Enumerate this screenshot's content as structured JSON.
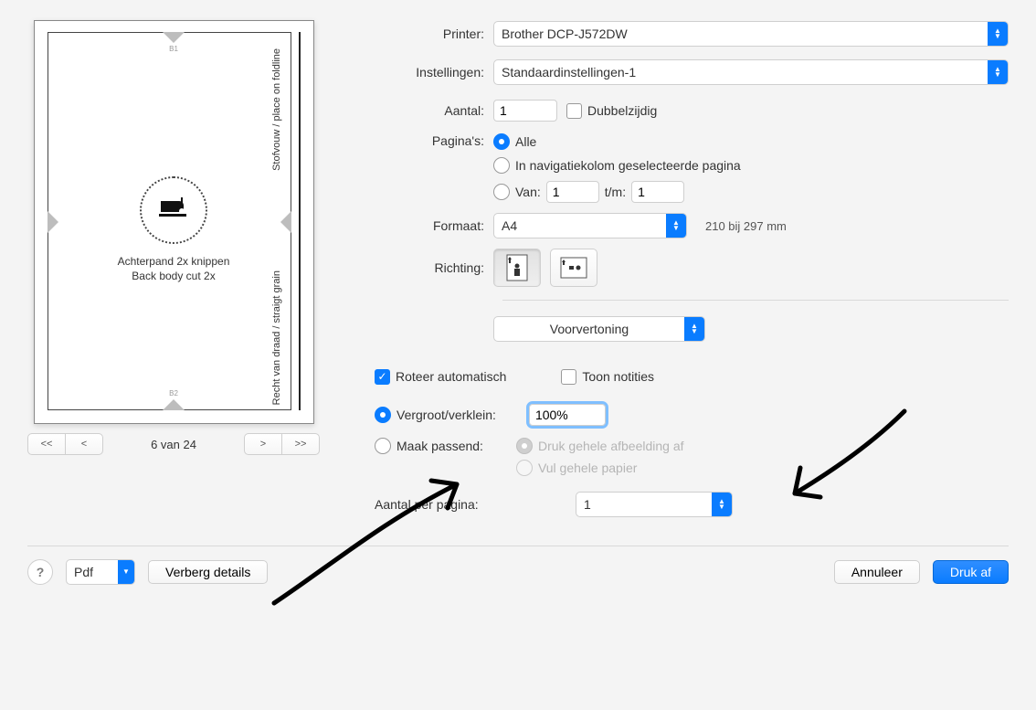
{
  "preview": {
    "fold_label": "Stofvouw / place on foldline",
    "grain_label": "Recht van draad / straigt grain",
    "center_line1": "Achterpand 2x knippen",
    "center_line2": "Back body cut 2x",
    "tag_top": "B1",
    "tag_bottom": "B2",
    "pager_label": "6 van 24"
  },
  "labels": {
    "printer": "Printer:",
    "settings": "Instellingen:",
    "copies": "Aantal:",
    "twosided": "Dubbelzijdig",
    "pages": "Pagina's:",
    "pages_all": "Alle",
    "pages_nav": "In navigatiekolom geselecteerde pagina",
    "pages_from": "Van:",
    "pages_to": "t/m:",
    "format": "Formaat:",
    "format_note": "210 bij 297 mm",
    "orientation": "Richting:",
    "preview_menu": "Voorvertoning",
    "rotate_auto": "Roteer automatisch",
    "show_notes": "Toon notities",
    "scale": "Vergroot/verklein:",
    "fit": "Maak passend:",
    "fit_whole": "Druk gehele afbeelding af",
    "fit_fill": "Vul gehele papier",
    "per_page": "Aantal per pagina:"
  },
  "values": {
    "printer": "Brother DCP-J572DW",
    "settings": "Standaardinstellingen-1",
    "copies": "1",
    "pages_from": "1",
    "pages_to": "1",
    "format": "A4",
    "scale": "100%",
    "per_page": "1"
  },
  "footer": {
    "pdf": "Pdf",
    "hide_details": "Verberg details",
    "cancel": "Annuleer",
    "print": "Druk af"
  }
}
